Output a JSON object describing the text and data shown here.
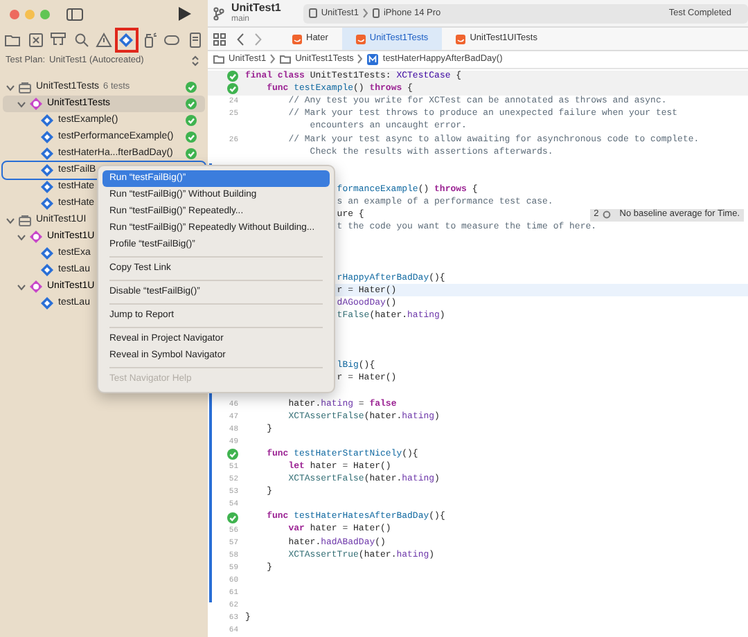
{
  "sidebar": {
    "nav_icons": [
      {
        "kind": "folder",
        "selected": false,
        "annotated": false
      },
      {
        "kind": "xbox",
        "selected": false,
        "annotated": false
      },
      {
        "kind": "hierarchy",
        "selected": false,
        "annotated": false
      },
      {
        "kind": "search",
        "selected": false,
        "annotated": false
      },
      {
        "kind": "warning",
        "selected": false,
        "annotated": false
      },
      {
        "kind": "diamond",
        "selected": true,
        "annotated": true
      },
      {
        "kind": "spray",
        "selected": false,
        "annotated": false
      },
      {
        "kind": "tag",
        "selected": false,
        "annotated": false
      },
      {
        "kind": "report",
        "selected": false,
        "annotated": false
      }
    ],
    "test_plan": {
      "label": "Test Plan:",
      "value": "UnitTest1 (Autocreated)"
    },
    "tree": [
      {
        "kind": "bundle",
        "label": "UnitTest1Tests",
        "count": "6 tests",
        "passed": true,
        "expanded": true,
        "selected": false,
        "menu_target": false,
        "children": [
          {
            "kind": "class",
            "label": "UnitTest1Tests",
            "passed": true,
            "expanded": true,
            "selected": true,
            "menu_target": false,
            "children": [
              {
                "kind": "test",
                "label": "testExample()",
                "passed": true,
                "selected": false,
                "menu_target": false
              },
              {
                "kind": "test",
                "label": "testPerformanceExample()",
                "passed": true,
                "selected": false,
                "menu_target": false
              },
              {
                "kind": "test",
                "label": "testHaterHa...fterBadDay()",
                "passed": true,
                "selected": false,
                "menu_target": false
              },
              {
                "kind": "test",
                "label": "testFailB",
                "passed": false,
                "selected": false,
                "menu_target": true
              },
              {
                "kind": "test",
                "label": "testHate",
                "passed": false,
                "selected": false,
                "menu_target": false
              },
              {
                "kind": "test",
                "label": "testHate",
                "passed": false,
                "selected": false,
                "menu_target": false
              }
            ]
          }
        ]
      },
      {
        "kind": "bundle",
        "label": "UnitTest1UI",
        "passed": false,
        "expanded": true,
        "selected": false,
        "menu_target": false,
        "children": [
          {
            "kind": "class",
            "label": "UnitTest1U",
            "passed": false,
            "expanded": true,
            "selected": false,
            "menu_target": false,
            "children": [
              {
                "kind": "test",
                "label": "testExa",
                "passed": false,
                "selected": false,
                "menu_target": false
              },
              {
                "kind": "test",
                "label": "testLau",
                "passed": false,
                "selected": false,
                "menu_target": false
              }
            ]
          },
          {
            "kind": "class",
            "label": "UnitTest1U",
            "passed": false,
            "expanded": true,
            "selected": false,
            "menu_target": false,
            "children": [
              {
                "kind": "test",
                "label": "testLau",
                "passed": false,
                "selected": false,
                "menu_target": false
              }
            ]
          }
        ]
      }
    ]
  },
  "editor": {
    "scheme": {
      "name": "UnitTest1",
      "branch": "main"
    },
    "destination": {
      "project": "UnitTest1",
      "device": "iPhone 14 Pro"
    },
    "status": "Test Completed",
    "tabs": [
      {
        "label": "Hater",
        "selected": false
      },
      {
        "label": "UnitTest1Tests",
        "selected": true
      },
      {
        "label": "UnitTest1UITests",
        "selected": false
      }
    ],
    "breadcrumb": [
      {
        "kind": "folder",
        "text": "UnitTest1"
      },
      {
        "kind": "folder",
        "text": "UnitTest1Tests"
      },
      {
        "kind": "method",
        "text": "testHaterHappyAfterBadDay()"
      }
    ],
    "lines": [
      {
        "kind": "sticky",
        "passed": true,
        "current": false,
        "tokens": [
          {
            "kind": "kw",
            "text": "final class"
          },
          {
            "kind": "plain",
            "text": " UnitTest1Tests: "
          },
          {
            "kind": "type",
            "text": "XCTestCase"
          },
          {
            "kind": "plain",
            "text": " {"
          }
        ]
      },
      {
        "kind": "sticky",
        "passed": true,
        "current": false,
        "tokens": [
          {
            "kind": "kw",
            "text": "    func "
          },
          {
            "kind": "decl",
            "text": "testExample"
          },
          {
            "kind": "plain",
            "text": "() "
          },
          {
            "kind": "kw",
            "text": "throws"
          },
          {
            "kind": "plain",
            "text": " {"
          }
        ]
      },
      {
        "kind": "full",
        "number": "24",
        "passed": false,
        "current": false,
        "tokens": [
          {
            "kind": "comment",
            "text": "        // Any test you write for XCTest can be annotated as throws and async."
          }
        ]
      },
      {
        "kind": "full",
        "number": "25",
        "passed": false,
        "current": false,
        "tokens": [
          {
            "kind": "comment",
            "text": "        // Mark your test throws to produce an unexpected failure when your test"
          }
        ]
      },
      {
        "kind": "full",
        "passed": false,
        "current": false,
        "tokens": [
          {
            "kind": "comment",
            "text": "            encounters an uncaught error."
          }
        ]
      },
      {
        "kind": "full",
        "number": "26",
        "passed": false,
        "current": false,
        "tokens": [
          {
            "kind": "comment",
            "text": "        // Mark your test async to allow awaiting for asynchronous code to complete."
          }
        ]
      },
      {
        "kind": "full",
        "passed": false,
        "current": false,
        "tokens": [
          {
            "kind": "comment",
            "text": "            Check the results with assertions afterwards."
          }
        ]
      },
      {
        "kind": "covered",
        "current": false
      },
      {
        "kind": "covered",
        "current": false
      },
      {
        "kind": "covered",
        "current": false,
        "tokens": [
          {
            "kind": "decl",
            "text": "formanceExample"
          },
          {
            "kind": "plain",
            "text": "() "
          },
          {
            "kind": "kw",
            "text": "throws"
          },
          {
            "kind": "plain",
            "text": " {"
          }
        ]
      },
      {
        "kind": "covered",
        "current": false,
        "tokens": [
          {
            "kind": "comment",
            "text": "s an example of a performance test case."
          }
        ]
      },
      {
        "kind": "covered",
        "current": false,
        "tokens": [
          {
            "kind": "plain",
            "text": "ure {"
          }
        ],
        "annotation": {
          "count": "2",
          "text": "No baseline average for Time."
        }
      },
      {
        "kind": "covered",
        "current": false,
        "tokens": [
          {
            "kind": "comment",
            "text": "t the code you want to measure the time of here."
          }
        ]
      },
      {
        "kind": "covered",
        "current": false
      },
      {
        "kind": "covered",
        "current": false
      },
      {
        "kind": "covered",
        "current": false
      },
      {
        "kind": "covered",
        "current": false,
        "tokens": [
          {
            "kind": "decl",
            "text": "rHappyAfterBadDay"
          },
          {
            "kind": "plain",
            "text": "(){"
          }
        ]
      },
      {
        "kind": "covered",
        "current": true,
        "tokens": [
          {
            "kind": "plain",
            "text": "r = Hater()"
          }
        ]
      },
      {
        "kind": "covered",
        "current": false,
        "tokens": [
          {
            "kind": "prop",
            "text": "dAGoodDay"
          },
          {
            "kind": "plain",
            "text": "()"
          }
        ]
      },
      {
        "kind": "covered",
        "current": false,
        "tokens": [
          {
            "kind": "call",
            "text": "tFalse"
          },
          {
            "kind": "plain",
            "text": "(hater."
          },
          {
            "kind": "prop",
            "text": "hating"
          },
          {
            "kind": "plain",
            "text": ")"
          }
        ]
      },
      {
        "kind": "covered",
        "current": false
      },
      {
        "kind": "covered",
        "current": false
      },
      {
        "kind": "covered",
        "current": false
      },
      {
        "kind": "covered",
        "current": false,
        "tokens": [
          {
            "kind": "decl",
            "text": "lBig"
          },
          {
            "kind": "plain",
            "text": "(){"
          }
        ]
      },
      {
        "kind": "covered",
        "current": false,
        "tokens": [
          {
            "kind": "plain",
            "text": "r = Hater()"
          }
        ]
      },
      {
        "kind": "covered",
        "current": false
      },
      {
        "kind": "full",
        "number": "46",
        "passed": false,
        "current": false,
        "tokens": [
          {
            "kind": "plain",
            "text": "        hater."
          },
          {
            "kind": "prop",
            "text": "hating"
          },
          {
            "kind": "plain",
            "text": " = "
          },
          {
            "kind": "kw",
            "text": "false"
          }
        ]
      },
      {
        "kind": "full",
        "number": "47",
        "passed": false,
        "current": false,
        "tokens": [
          {
            "kind": "call",
            "text": "        XCTAssertFalse"
          },
          {
            "kind": "plain",
            "text": "(hater."
          },
          {
            "kind": "prop",
            "text": "hating"
          },
          {
            "kind": "plain",
            "text": ")"
          }
        ]
      },
      {
        "kind": "full",
        "number": "48",
        "passed": false,
        "current": false,
        "tokens": [
          {
            "kind": "plain",
            "text": "    }"
          }
        ]
      },
      {
        "kind": "full",
        "number": "49",
        "passed": false,
        "current": false
      },
      {
        "kind": "full",
        "passed": true,
        "current": false,
        "tokens": [
          {
            "kind": "kw",
            "text": "    func "
          },
          {
            "kind": "decl",
            "text": "testHaterStartNicely"
          },
          {
            "kind": "plain",
            "text": "(){"
          }
        ]
      },
      {
        "kind": "full",
        "number": "51",
        "passed": false,
        "current": false,
        "tokens": [
          {
            "kind": "kw",
            "text": "        let"
          },
          {
            "kind": "plain",
            "text": " hater = Hater()"
          }
        ]
      },
      {
        "kind": "full",
        "number": "52",
        "passed": false,
        "current": false,
        "tokens": [
          {
            "kind": "call",
            "text": "        XCTAssertFalse"
          },
          {
            "kind": "plain",
            "text": "(hater."
          },
          {
            "kind": "prop",
            "text": "hating"
          },
          {
            "kind": "plain",
            "text": ")"
          }
        ]
      },
      {
        "kind": "full",
        "number": "53",
        "passed": false,
        "current": false,
        "tokens": [
          {
            "kind": "plain",
            "text": "    }"
          }
        ]
      },
      {
        "kind": "full",
        "number": "54",
        "passed": false,
        "current": false
      },
      {
        "kind": "full",
        "passed": true,
        "current": false,
        "tokens": [
          {
            "kind": "kw",
            "text": "    func "
          },
          {
            "kind": "decl",
            "text": "testHaterHatesAfterBadDay"
          },
          {
            "kind": "plain",
            "text": "(){"
          }
        ]
      },
      {
        "kind": "full",
        "number": "56",
        "passed": false,
        "current": false,
        "tokens": [
          {
            "kind": "kw",
            "text": "        var"
          },
          {
            "kind": "plain",
            "text": " hater = Hater()"
          }
        ]
      },
      {
        "kind": "full",
        "number": "57",
        "passed": false,
        "current": false,
        "tokens": [
          {
            "kind": "plain",
            "text": "        hater."
          },
          {
            "kind": "prop",
            "text": "hadABadDay"
          },
          {
            "kind": "plain",
            "text": "()"
          }
        ]
      },
      {
        "kind": "full",
        "number": "58",
        "passed": false,
        "current": false,
        "tokens": [
          {
            "kind": "call",
            "text": "        XCTAssertTrue"
          },
          {
            "kind": "plain",
            "text": "(hater."
          },
          {
            "kind": "prop",
            "text": "hating"
          },
          {
            "kind": "plain",
            "text": ")"
          }
        ]
      },
      {
        "kind": "full",
        "number": "59",
        "passed": false,
        "current": false,
        "tokens": [
          {
            "kind": "plain",
            "text": "    }"
          }
        ]
      },
      {
        "kind": "full",
        "number": "60",
        "passed": false,
        "current": false
      },
      {
        "kind": "full",
        "number": "61",
        "passed": false,
        "current": false
      },
      {
        "kind": "full",
        "number": "62",
        "passed": false,
        "current": false
      },
      {
        "kind": "full",
        "number": "63",
        "passed": false,
        "current": false,
        "tokens": [
          {
            "kind": "plain",
            "text": "}"
          }
        ]
      },
      {
        "kind": "full",
        "number": "64",
        "passed": false,
        "current": false
      }
    ]
  },
  "context_menu": [
    {
      "kind": "item",
      "text": "Run “testFailBig()”",
      "selected": true,
      "disabled": false
    },
    {
      "kind": "item",
      "text": "Run “testFailBig()” Without Building",
      "selected": false,
      "disabled": false
    },
    {
      "kind": "item",
      "text": "Run “testFailBig()” Repeatedly...",
      "selected": false,
      "disabled": false
    },
    {
      "kind": "item",
      "text": "Run “testFailBig()” Repeatedly Without Building...",
      "selected": false,
      "disabled": false
    },
    {
      "kind": "item",
      "text": "Profile “testFailBig()”",
      "selected": false,
      "disabled": false
    },
    {
      "kind": "separator"
    },
    {
      "kind": "item",
      "text": "Copy Test Link",
      "selected": false,
      "disabled": false
    },
    {
      "kind": "separator"
    },
    {
      "kind": "item",
      "text": "Disable “testFailBig()”",
      "selected": false,
      "disabled": false
    },
    {
      "kind": "separator"
    },
    {
      "kind": "item",
      "text": "Jump to Report",
      "selected": false,
      "disabled": false
    },
    {
      "kind": "separator"
    },
    {
      "kind": "item",
      "text": "Reveal in Project Navigator",
      "selected": false,
      "disabled": false
    },
    {
      "kind": "item",
      "text": "Reveal in Symbol Navigator",
      "selected": false,
      "disabled": false
    },
    {
      "kind": "separator"
    },
    {
      "kind": "item",
      "text": "Test Navigator Help",
      "selected": false,
      "disabled": true
    }
  ]
}
